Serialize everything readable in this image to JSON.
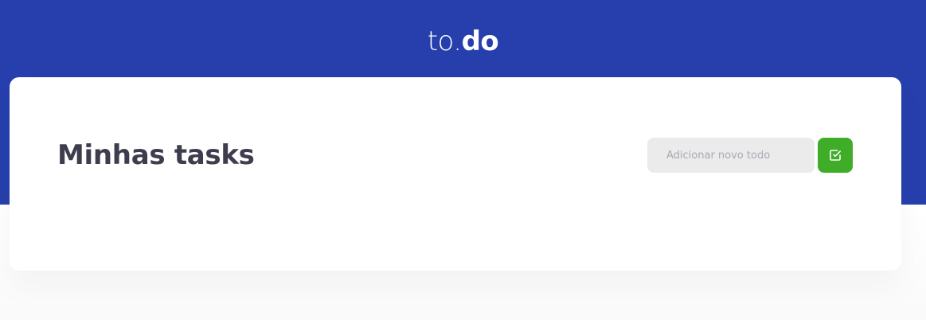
{
  "header": {
    "logo_prefix": "to.",
    "logo_suffix": "do",
    "background_color": "#273FAD"
  },
  "card": {
    "title": "Minhas tasks"
  },
  "new_todo": {
    "placeholder": "Adicionar novo todo",
    "value": "",
    "submit_icon": "check-square-icon",
    "button_color": "#3FAD27"
  },
  "colors": {
    "title_text": "#3D3D4D",
    "input_background": "#EBEBEB",
    "placeholder_text": "#A8A8B3"
  }
}
